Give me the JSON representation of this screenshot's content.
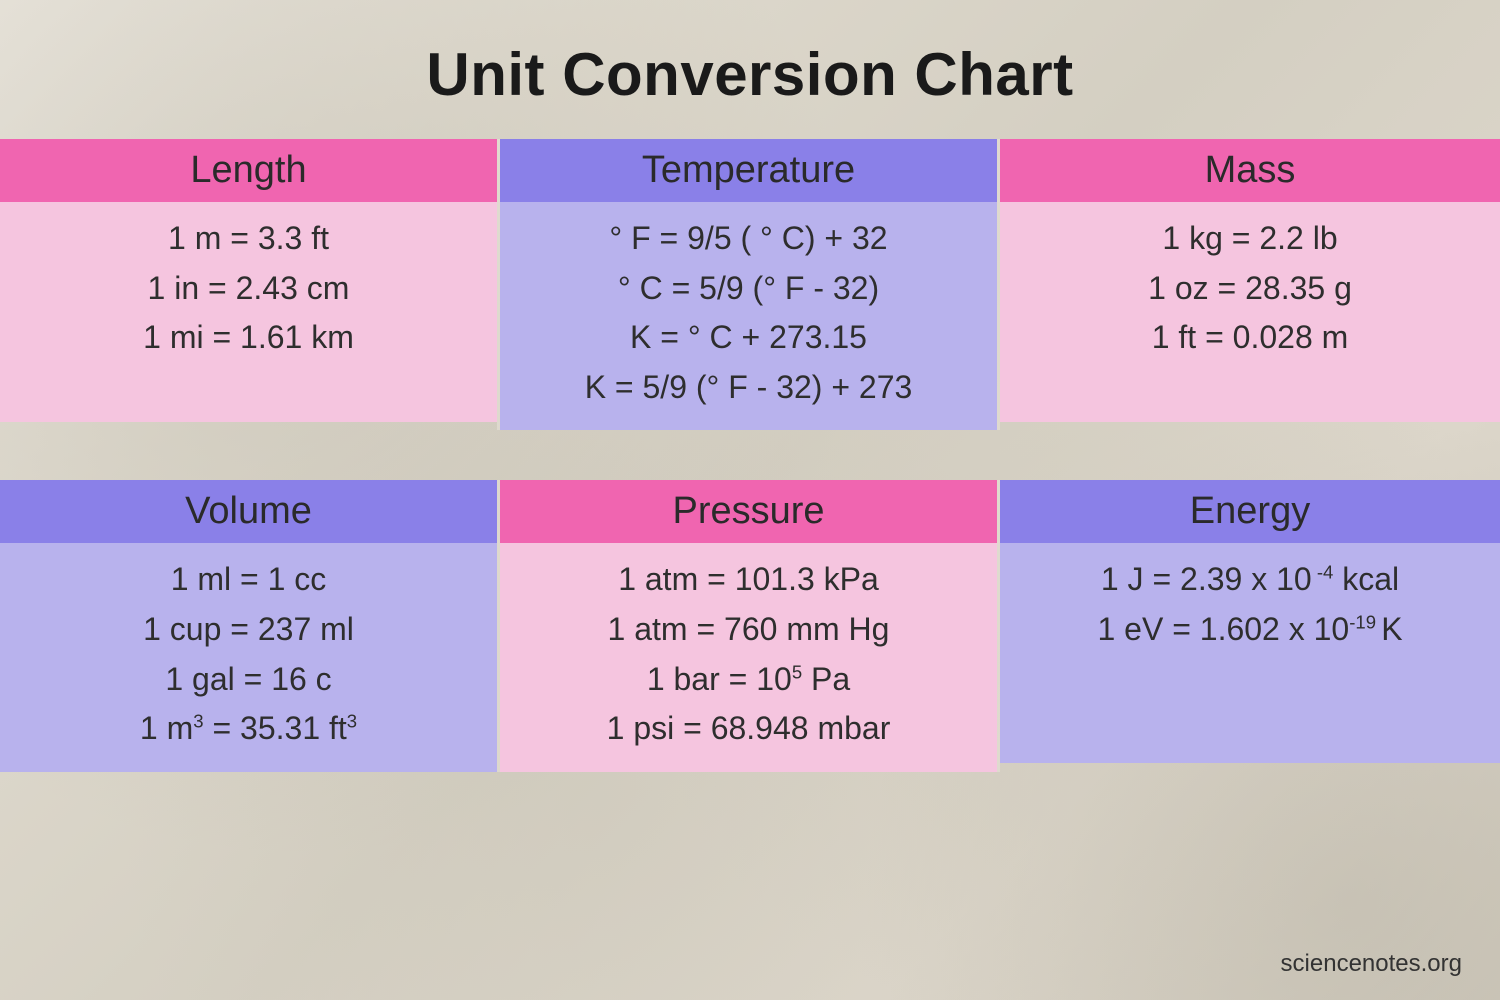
{
  "chart_data": {
    "type": "table",
    "title": "Unit Conversion Chart",
    "attribution": "sciencenotes.org",
    "categories": [
      {
        "name": "Length",
        "color_scheme": "pink",
        "conversions": [
          "1 m = 3.3 ft",
          "1 in = 2.43 cm",
          "1 mi = 1.61 km"
        ]
      },
      {
        "name": "Temperature",
        "color_scheme": "purple",
        "conversions": [
          "° F = 9/5 ( ° C) + 32",
          "° C = 5/9 (° F - 32)",
          "K = ° C + 273.15",
          "K = 5/9 (° F - 32) + 273"
        ]
      },
      {
        "name": "Mass",
        "color_scheme": "pink",
        "conversions": [
          "1  kg = 2.2 lb",
          "1 oz = 28.35 g",
          "1 ft  = 0.028 m"
        ]
      },
      {
        "name": "Volume",
        "color_scheme": "purple",
        "conversions": [
          "1  ml = 1 cc",
          "1 cup = 237 ml",
          "1 gal = 16 c",
          "1 m³  = 35.31 ft³"
        ]
      },
      {
        "name": "Pressure",
        "color_scheme": "pink",
        "conversions": [
          "1 atm = 101.3 kPa",
          "1 atm = 760 mm Hg",
          "1 bar = 10⁵ Pa",
          "1 psi = 68.948 mbar"
        ]
      },
      {
        "name": "Energy",
        "color_scheme": "purple",
        "conversions": [
          "1 J = 2.39 x 10⁻⁴ kcal",
          "1 eV = 1.602 x 10⁻¹⁹ K"
        ]
      }
    ]
  },
  "title": "Unit Conversion Chart",
  "attribution": "sciencenotes.org",
  "cards": {
    "length": {
      "header": "Length",
      "lines": [
        "1 m = 3.3 ft",
        "1 in = 2.43 cm",
        "1 mi = 1.61 km"
      ]
    },
    "temperature": {
      "header": "Temperature",
      "lines": [
        "° F = 9/5 ( ° C) + 32",
        "° C = 5/9 (° F - 32)",
        "K = ° C + 273.15",
        "K = 5/9 (° F - 32) + 273"
      ]
    },
    "mass": {
      "header": "Mass",
      "lines": [
        "1  kg = 2.2 lb",
        "1 oz = 28.35 g",
        "1 ft  = 0.028 m"
      ]
    },
    "volume": {
      "header": "Volume",
      "lines": [
        "1  ml = 1 cc",
        "1 cup = 237 ml",
        "1 gal = 16 c",
        "1 m<sup>3</sup>  = 35.31 ft<sup>3</sup>"
      ]
    },
    "pressure": {
      "header": "Pressure",
      "lines": [
        "1 atm = 101.3 kPa",
        "1 atm = 760 mm Hg",
        "1 bar = 10<sup>5</sup> Pa",
        "1 psi = 68.948 mbar"
      ]
    },
    "energy": {
      "header": "Energy",
      "lines": [
        "1 J = 2.39 x 10<sup> -4</sup> kcal",
        "1 eV = 1.602 x 10<sup>-19 </sup>K"
      ]
    }
  }
}
